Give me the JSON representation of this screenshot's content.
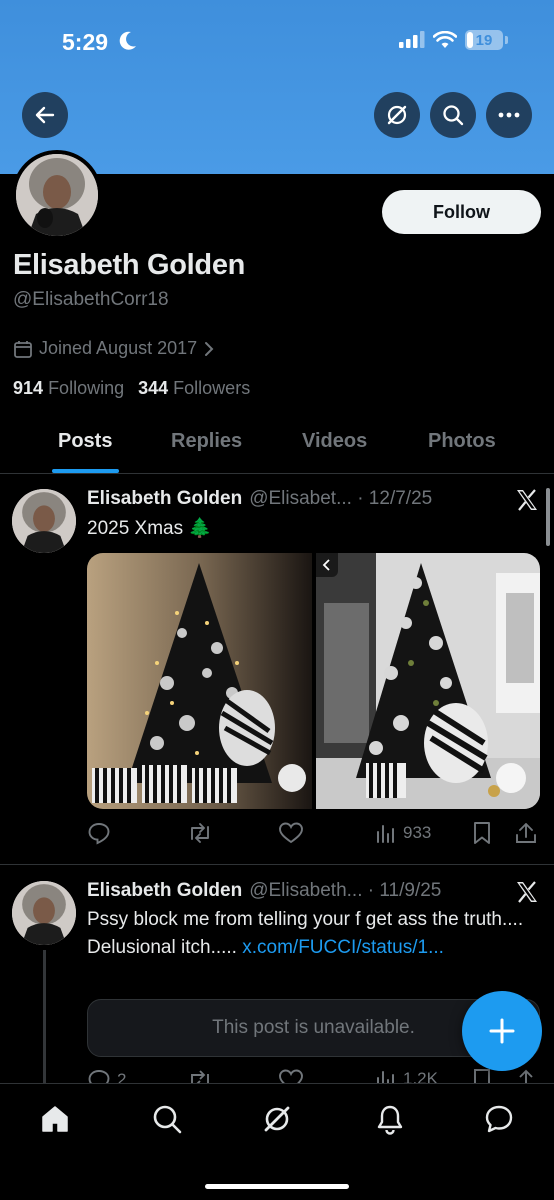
{
  "status_bar": {
    "time": "5:29",
    "battery": "19",
    "battery_level": 0.19
  },
  "header_buttons": {
    "back": "arrow-left-icon",
    "grok": "grok-icon",
    "search": "search-icon",
    "more": "more-icon"
  },
  "profile": {
    "name": "Elisabeth Golden",
    "handle": "@ElisabethCorr18",
    "joined": "Joined August 2017",
    "following_count": "914",
    "following_label": "Following",
    "followers_count": "344",
    "followers_label": "Followers",
    "follow_label": "Follow"
  },
  "tabs": [
    {
      "label": "Posts",
      "active": true
    },
    {
      "label": "Replies",
      "active": false
    },
    {
      "label": "Videos",
      "active": false
    },
    {
      "label": "Photos",
      "active": false
    }
  ],
  "posts": [
    {
      "name": "Elisabeth Golden",
      "handle_date": "@Elisabet... · 12/7/25",
      "text": "2025 Xmas 🌲",
      "views": "933"
    },
    {
      "name": "Elisabeth Golden",
      "handle_date": "@Elisabeth... · 11/9/25",
      "text": "Pssy block me from telling your f get ass the truth.... Delusional itch..... ",
      "link": "x.com/FUCCI/status/1...",
      "quote": "This post is unavailable.",
      "replies": "2",
      "views": "1.2K"
    }
  ],
  "colors": {
    "banner": "#4a9be6",
    "accent": "#1d9bf0",
    "background": "#000000",
    "muted": "#71767b"
  }
}
